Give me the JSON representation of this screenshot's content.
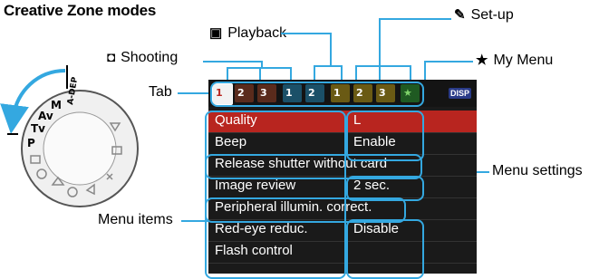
{
  "heading": "Creative Zone modes",
  "callouts": {
    "playback": "Playback",
    "setup": "Set-up",
    "shooting": "Shooting",
    "my_menu": "My Menu",
    "tab": "Tab",
    "menu_items": "Menu items",
    "menu_settings": "Menu settings"
  },
  "dial_modes": [
    "A-DEP",
    "M",
    "Av",
    "Tv",
    "P"
  ],
  "lcd": {
    "disp_label": "DISP",
    "tabs": [
      {
        "group": "shooting",
        "glyph": "1",
        "active": true
      },
      {
        "group": "shooting",
        "glyph": "2"
      },
      {
        "group": "shooting",
        "glyph": "3"
      },
      {
        "group": "playback",
        "glyph": "1"
      },
      {
        "group": "playback",
        "glyph": "2"
      },
      {
        "group": "setup",
        "glyph": "1"
      },
      {
        "group": "setup",
        "glyph": "2"
      },
      {
        "group": "setup",
        "glyph": "3"
      },
      {
        "group": "my_menu",
        "glyph": "★"
      }
    ],
    "menu": [
      {
        "label": "Quality",
        "value": "L",
        "selected": true
      },
      {
        "label": "Beep",
        "value": "Enable"
      },
      {
        "label": "Release shutter without card",
        "value": ""
      },
      {
        "label": "Image review",
        "value": "2 sec."
      },
      {
        "label": "Peripheral illumin. correct.",
        "value": ""
      },
      {
        "label": "Red-eye reduc.",
        "value": "Disable"
      },
      {
        "label": "Flash control",
        "value": ""
      }
    ]
  },
  "colors": {
    "callout_line": "#34a8e0",
    "selected_row": "#b8251f",
    "lcd_bg": "#1a1a1a"
  }
}
